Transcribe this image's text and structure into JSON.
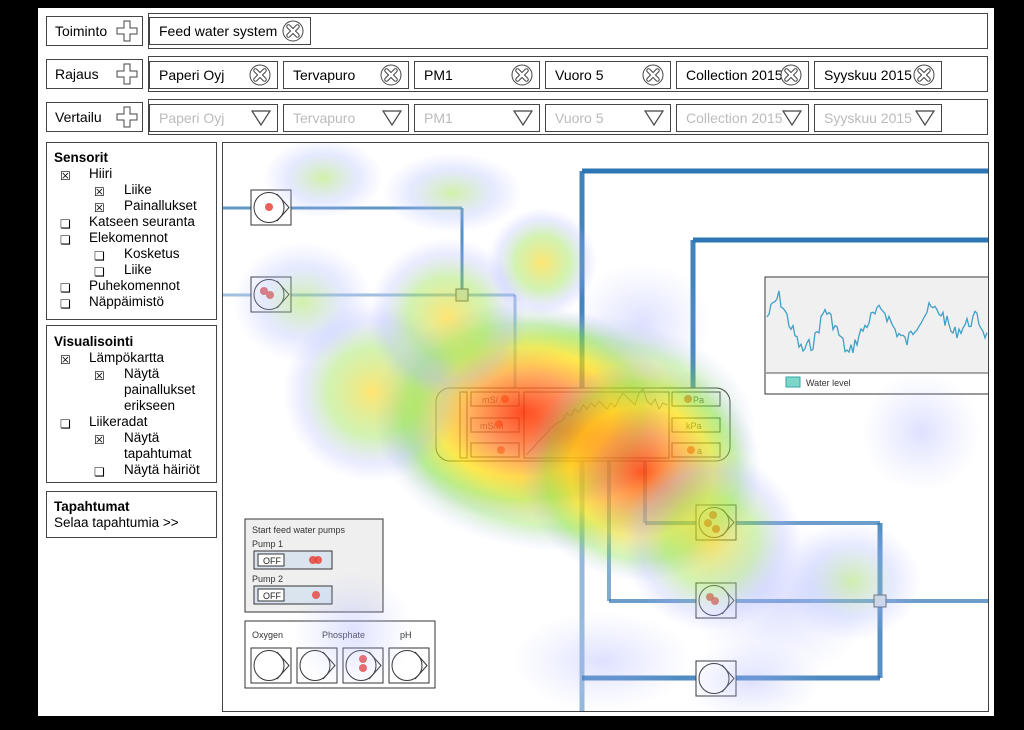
{
  "filters": {
    "action": {
      "label": "Toiminto",
      "chips": [
        {
          "text": "Feed water system"
        }
      ]
    },
    "scope": {
      "label": "Rajaus",
      "chips": [
        {
          "text": "Paperi Oyj"
        },
        {
          "text": "Tervapuro"
        },
        {
          "text": "PM1"
        },
        {
          "text": "Vuoro 5"
        },
        {
          "text": "Collection 2015"
        },
        {
          "text": "Syyskuu 2015"
        }
      ]
    },
    "compare": {
      "label": "Vertailu",
      "dropdowns": [
        {
          "text": "Paperi Oyj"
        },
        {
          "text": "Tervapuro"
        },
        {
          "text": "PM1"
        },
        {
          "text": "Vuoro 5"
        },
        {
          "text": "Collection 2015"
        },
        {
          "text": "Syyskuu 2015"
        }
      ]
    }
  },
  "sensors": {
    "title": "Sensorit",
    "items": [
      {
        "label": "Hiiri",
        "checked": true,
        "level": 1
      },
      {
        "label": "Liike",
        "checked": true,
        "level": 2
      },
      {
        "label": "Painallukset",
        "checked": true,
        "level": 2
      },
      {
        "label": "Katseen seuranta",
        "checked": false,
        "level": 1
      },
      {
        "label": "Elekomennot",
        "checked": false,
        "level": 1
      },
      {
        "label": "Kosketus",
        "checked": false,
        "level": 2
      },
      {
        "label": "Liike",
        "checked": false,
        "level": 2
      },
      {
        "label": "Puhekomennot",
        "checked": false,
        "level": 1
      },
      {
        "label": "Näppäimistö",
        "checked": false,
        "level": 1
      }
    ]
  },
  "visualization": {
    "title": "Visualisointi",
    "heatmap": {
      "label": "Lämpökartta",
      "checked": true
    },
    "show_clicks": {
      "lines": [
        "Näytä",
        "painallukset",
        "erikseen"
      ],
      "checked": true
    },
    "trails": {
      "label": "Liikeradat",
      "checked": false
    },
    "show_events": {
      "lines": [
        "Näytä",
        "tapahtumat"
      ],
      "checked": true
    },
    "show_errors": {
      "label": "Näytä häiriöt",
      "checked": false
    }
  },
  "events": {
    "title": "Tapahtumat",
    "link": "Selaa tapahtumia >>"
  },
  "process": {
    "central_left_units": [
      "mS/",
      "mS/m",
      ""
    ],
    "central_right_units": [
      "Pa",
      "kPa",
      "a"
    ],
    "water_level_legend": "Water level",
    "pumps": {
      "title": "Start feed water pumps",
      "pump1_label": "Pump 1",
      "pump2_label": "Pump 2",
      "pump1_state": "OFF",
      "pump2_state": "OFF"
    },
    "analyzers": {
      "oxygen": "Oxygen",
      "phosphate": "Phosphate",
      "ph": "pH"
    }
  },
  "colors": {
    "pipe": "#2e75b6",
    "pipe_light": "#9dc3e6",
    "click_dot": "#e8453c",
    "heat_hot": "#ff2000",
    "heat_warm": "#ffd000",
    "heat_mid": "#a0e040",
    "heat_cool": "#b0b8ff"
  }
}
